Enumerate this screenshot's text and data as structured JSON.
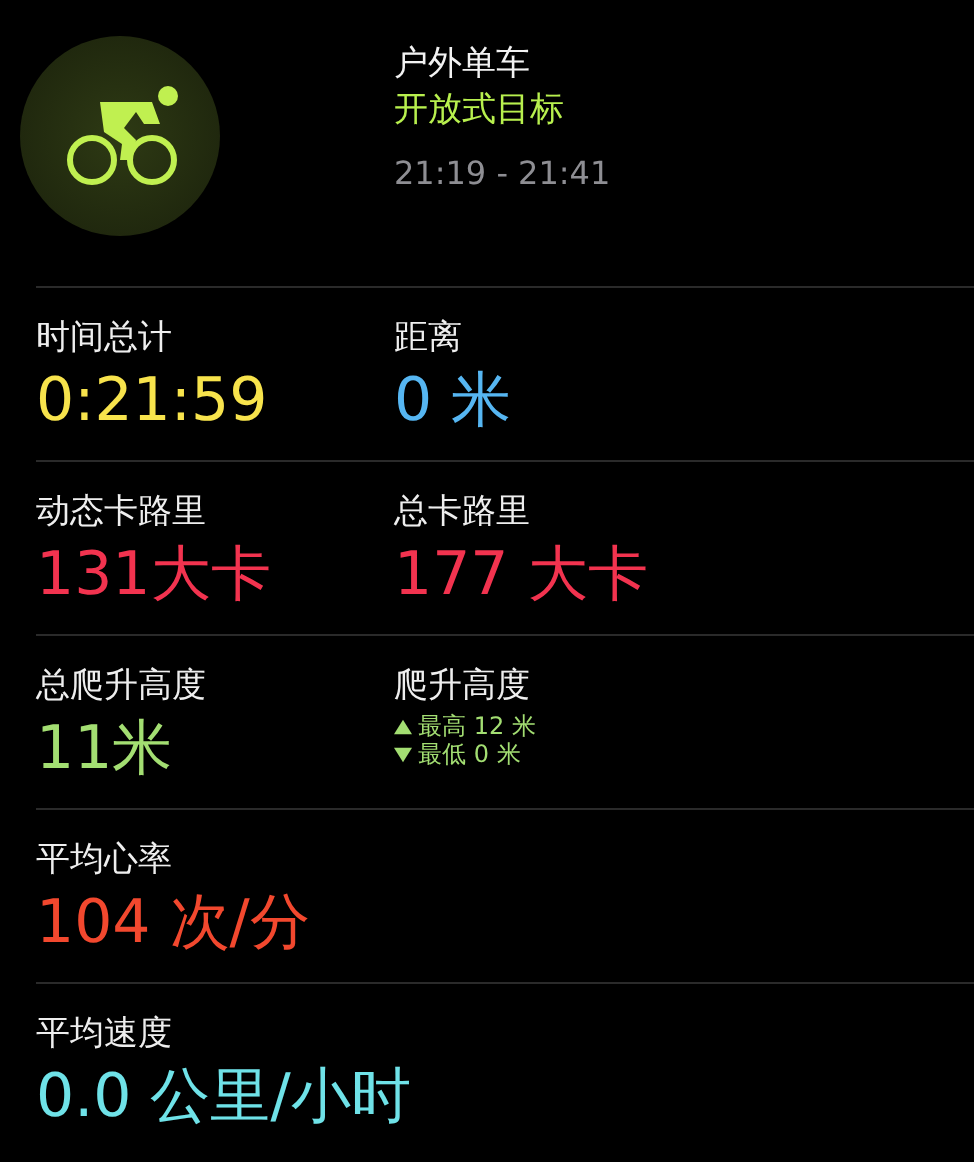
{
  "workout": {
    "title": "户外单车",
    "goal": "开放式目标",
    "time_range": "21:19 - 21:41"
  },
  "rows": [
    {
      "cells": [
        {
          "kind": "value",
          "label": "时间总计",
          "value": "0:21:59",
          "color": "#f7e34c"
        },
        {
          "kind": "value",
          "label": "距离",
          "value": "0 米",
          "color": "#56b6f2"
        }
      ]
    },
    {
      "cells": [
        {
          "kind": "value",
          "label": "动态卡路里",
          "value": "131大卡",
          "color": "#f2334f"
        },
        {
          "kind": "value",
          "label": "总卡路里",
          "value": "177 大卡",
          "color": "#f2334f"
        }
      ]
    },
    {
      "cells": [
        {
          "kind": "value",
          "label": "总爬升高度",
          "value": "11米",
          "color": "#a3de72"
        },
        {
          "kind": "range",
          "label": "爬升高度",
          "color": "#a3de72",
          "lines": [
            {
              "kind": "up",
              "text": "最高 12 米"
            },
            {
              "kind": "down",
              "text": "最低 0 米"
            }
          ]
        }
      ]
    },
    {
      "cells": [
        {
          "kind": "value",
          "label": "平均心率",
          "value": "104 次/分",
          "color": "#f2482e"
        }
      ]
    },
    {
      "cells": [
        {
          "kind": "value",
          "label": "平均速度",
          "value": "0.0 公里/小时",
          "color": "#6fe2e8"
        }
      ]
    }
  ]
}
